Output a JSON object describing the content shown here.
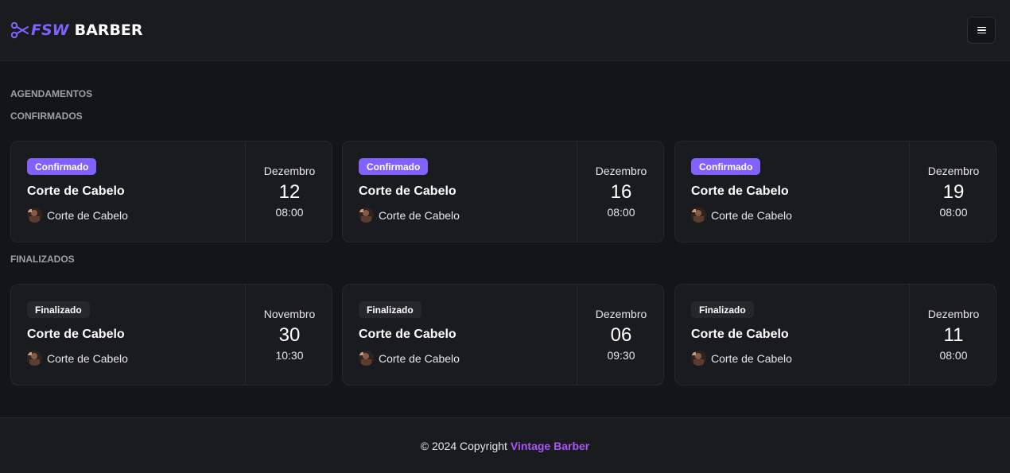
{
  "header": {
    "logo": {
      "part1": "FSW",
      "part2": "BARBER"
    },
    "menu_icon": "hamburger-menu-icon"
  },
  "sections": {
    "title": "AGENDAMENTOS",
    "confirmed": "CONFIRMADOS",
    "finished": "FINALIZADOS"
  },
  "confirmed": [
    {
      "status": "Confirmado",
      "service": "Corte de Cabelo",
      "barber": "Corte de Cabelo",
      "month": "Dezembro",
      "day": "12",
      "time": "08:00"
    },
    {
      "status": "Confirmado",
      "service": "Corte de Cabelo",
      "barber": "Corte de Cabelo",
      "month": "Dezembro",
      "day": "16",
      "time": "08:00"
    },
    {
      "status": "Confirmado",
      "service": "Corte de Cabelo",
      "barber": "Corte de Cabelo",
      "month": "Dezembro",
      "day": "19",
      "time": "08:00"
    }
  ],
  "finished": [
    {
      "status": "Finalizado",
      "service": "Corte de Cabelo",
      "barber": "Corte de Cabelo",
      "month": "Novembro",
      "day": "30",
      "time": "10:30"
    },
    {
      "status": "Finalizado",
      "service": "Corte de Cabelo",
      "barber": "Corte de Cabelo",
      "month": "Dezembro",
      "day": "06",
      "time": "09:30"
    },
    {
      "status": "Finalizado",
      "service": "Corte de Cabelo",
      "barber": "Corte de Cabelo",
      "month": "Dezembro",
      "day": "11",
      "time": "08:00"
    }
  ],
  "footer": {
    "text": "© 2024 Copyright",
    "brand": "Vintage Barber"
  },
  "colors": {
    "accent": "#8162ff",
    "background": "#141519",
    "card": "#1a1b1f",
    "footer_brand": "#a855f7"
  }
}
